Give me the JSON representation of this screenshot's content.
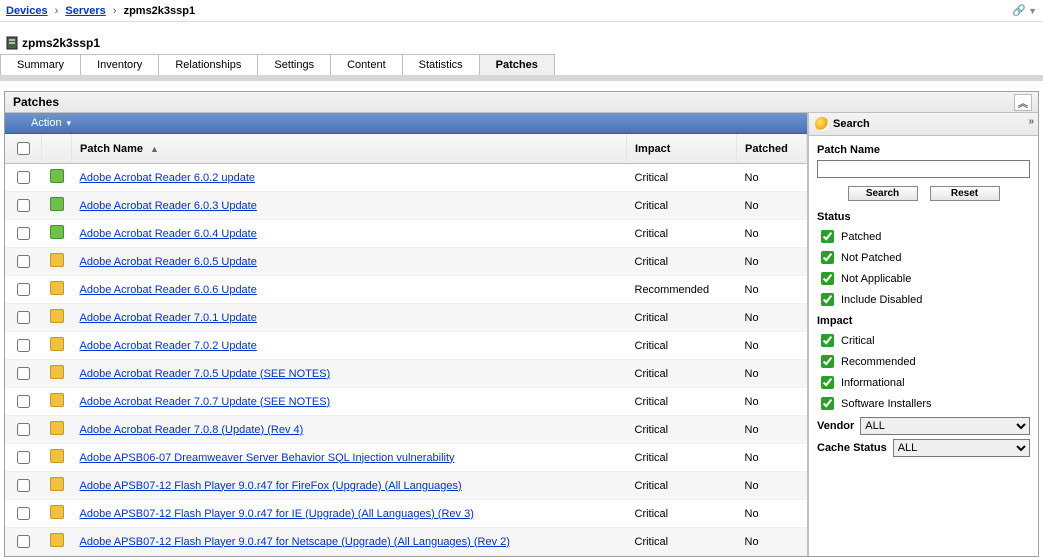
{
  "breadcrumb": {
    "root": "Devices",
    "mid": "Servers",
    "current": "zpms2k3ssp1"
  },
  "page": {
    "title": "zpms2k3ssp1"
  },
  "tabs": [
    {
      "label": "Summary"
    },
    {
      "label": "Inventory"
    },
    {
      "label": "Relationships"
    },
    {
      "label": "Settings"
    },
    {
      "label": "Content"
    },
    {
      "label": "Statistics"
    },
    {
      "label": "Patches"
    }
  ],
  "patches_panel": {
    "title": "Patches",
    "action_label": "Action",
    "columns": {
      "name": "Patch Name",
      "impact": "Impact",
      "patched": "Patched"
    }
  },
  "rows": [
    {
      "icon": "green",
      "name": "Adobe Acrobat Reader 6.0.2 update",
      "impact": "Critical",
      "patched": "No"
    },
    {
      "icon": "green",
      "name": "Adobe Acrobat Reader 6.0.3 Update",
      "impact": "Critical",
      "patched": "No"
    },
    {
      "icon": "green",
      "name": "Adobe Acrobat Reader 6.0.4 Update",
      "impact": "Critical",
      "patched": "No"
    },
    {
      "icon": "yellow",
      "name": "Adobe Acrobat Reader 6.0.5 Update",
      "impact": "Critical",
      "patched": "No"
    },
    {
      "icon": "yellow",
      "name": "Adobe Acrobat Reader 6.0.6 Update",
      "impact": "Recommended",
      "patched": "No"
    },
    {
      "icon": "yellow",
      "name": "Adobe Acrobat Reader 7.0.1 Update",
      "impact": "Critical",
      "patched": "No"
    },
    {
      "icon": "yellow",
      "name": "Adobe Acrobat Reader 7.0.2 Update",
      "impact": "Critical",
      "patched": "No"
    },
    {
      "icon": "yellow",
      "name": "Adobe Acrobat Reader 7.0.5 Update (SEE NOTES)",
      "impact": "Critical",
      "patched": "No"
    },
    {
      "icon": "yellow",
      "name": "Adobe Acrobat Reader 7.0.7 Update (SEE NOTES)",
      "impact": "Critical",
      "patched": "No"
    },
    {
      "icon": "yellow",
      "name": "Adobe Acrobat Reader 7.0.8 (Update) (Rev 4)",
      "impact": "Critical",
      "patched": "No"
    },
    {
      "icon": "yellow",
      "name": "Adobe APSB06-07 Dreamweaver Server Behavior SQL Injection vulnerability",
      "impact": "Critical",
      "patched": "No"
    },
    {
      "icon": "yellow",
      "name": "Adobe APSB07-12 Flash Player 9.0.r47 for FireFox (Upgrade) (All Languages)",
      "impact": "Critical",
      "patched": "No"
    },
    {
      "icon": "yellow",
      "name": "Adobe APSB07-12 Flash Player 9.0.r47 for IE (Upgrade) (All Languages) (Rev 3)",
      "impact": "Critical",
      "patched": "No"
    },
    {
      "icon": "yellow",
      "name": "Adobe APSB07-12 Flash Player 9.0.r47 for Netscape (Upgrade) (All Languages) (Rev 2)",
      "impact": "Critical",
      "patched": "No"
    }
  ],
  "search": {
    "title": "Search",
    "patch_name_label": "Patch Name",
    "patch_name_value": "",
    "btn_search": "Search",
    "btn_reset": "Reset",
    "status_label": "Status",
    "status": [
      {
        "label": "Patched",
        "checked": true
      },
      {
        "label": "Not Patched",
        "checked": true
      },
      {
        "label": "Not Applicable",
        "checked": true
      },
      {
        "label": "Include Disabled",
        "checked": true
      }
    ],
    "impact_label": "Impact",
    "impact": [
      {
        "label": "Critical",
        "checked": true
      },
      {
        "label": "Recommended",
        "checked": true
      },
      {
        "label": "Informational",
        "checked": true
      },
      {
        "label": "Software Installers",
        "checked": true
      }
    ],
    "vendor_label": "Vendor",
    "vendor_value": "ALL",
    "cache_label": "Cache Status",
    "cache_value": "ALL"
  }
}
